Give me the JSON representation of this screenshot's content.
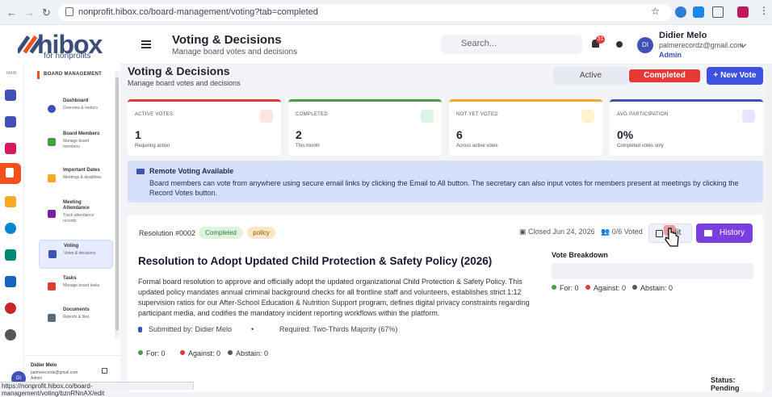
{
  "browser": {
    "url": "nonprofit.hibox.co/board-management/voting?tab=completed",
    "status_url": "https://nonprofit.hibox.co/board-management/voting/bznRNnAX/edit"
  },
  "logo": {
    "name": "hibox",
    "sub": "for nonprofits"
  },
  "header": {
    "title": "Voting & Decisions",
    "subtitle": "Manage board votes and decisions",
    "search_placeholder": "Search...",
    "notif_count": "31",
    "user_name": "Didier Melo",
    "user_email": "palmerecordz@gmail.com",
    "user_role": "Admin",
    "user_initials": "DI"
  },
  "rail": {
    "label": "MAIN"
  },
  "sidebar": {
    "heading": "BOARD MANAGEMENT",
    "items": [
      {
        "title": "Dashboard",
        "desc": [
          "Overview & metrics"
        ]
      },
      {
        "title": "Board Members",
        "desc": [
          "Manage board",
          "members"
        ]
      },
      {
        "title": "Important Dates",
        "desc": [
          "Meetings & deadlines"
        ]
      },
      {
        "title": "Meeting",
        "title2": "Attendance",
        "desc": [
          "Track attendance",
          "records"
        ]
      },
      {
        "title": "Voting",
        "desc": [
          "Votes & decisions"
        ]
      },
      {
        "title": "Tasks",
        "desc": [
          "Manage board tasks"
        ]
      },
      {
        "title": "Documents",
        "desc": [
          "Reports & files"
        ]
      }
    ],
    "user": {
      "name": "Didier Melo",
      "email": "palmerecordz@gmail.com",
      "role": "Admin",
      "initials": "DI"
    }
  },
  "page": {
    "title": "Voting & Decisions",
    "subtitle": "Manage board votes and decisions",
    "tab_active": "Active",
    "tab_completed": "Completed",
    "new_vote": "+ New Vote"
  },
  "stats": [
    {
      "label": "ACTIVE VOTES",
      "value": "1",
      "note": "Requiring action",
      "color": "#e53935"
    },
    {
      "label": "COMPLETED",
      "value": "2",
      "note": "This month",
      "color": "#43a047"
    },
    {
      "label": "NOT YET VOTED",
      "value": "6",
      "note": "Across active votes",
      "color": "#f9a825"
    },
    {
      "label": "AVG PARTICIPATION",
      "value": "0%",
      "note": "Completed votes only",
      "color": "#3f51b5"
    }
  ],
  "banner": {
    "title": "Remote Voting Available",
    "text": "Board members can vote from anywhere using secure email links by clicking the Email to All button. The secretary can also input votes for members present at meetings by clicking the Record Votes button."
  },
  "resolution": {
    "number": "Resolution #0002",
    "status_pill": "Completed",
    "category_pill": "policy",
    "closed": "Closed Jun 24, 2026",
    "voted": "0/6 Voted",
    "edit_label": "Edit",
    "history_label": "History",
    "title": "Resolution to Adopt Updated Child Protection & Safety Policy (2026)",
    "description": "Formal board resolution to approve and officially adopt the updated organizational Child Protection & Safety Policy. This updated policy mandates annual criminal background checks for all frontline staff and volunteers, establishes strict 1:12 supervision ratios for our After-School Education & Nutrition Support program, defines digital privacy constraints regarding participant media, and codifies the mandatory incident reporting workflows within the platform.",
    "submitted_by": "Submitted by: Didier Melo",
    "separator": "•",
    "required": "Required: Two-Thirds Majority (67%)",
    "breakdown_title": "Vote Breakdown",
    "for": "For: 0",
    "against": "Against: 0",
    "abstain": "Abstain: 0",
    "status": "Status: Pending"
  },
  "colors": {
    "accent": "#3f51e0",
    "danger": "#e53935",
    "success": "#43a047",
    "purple": "#7a3fe0",
    "abstain": "#555555"
  }
}
